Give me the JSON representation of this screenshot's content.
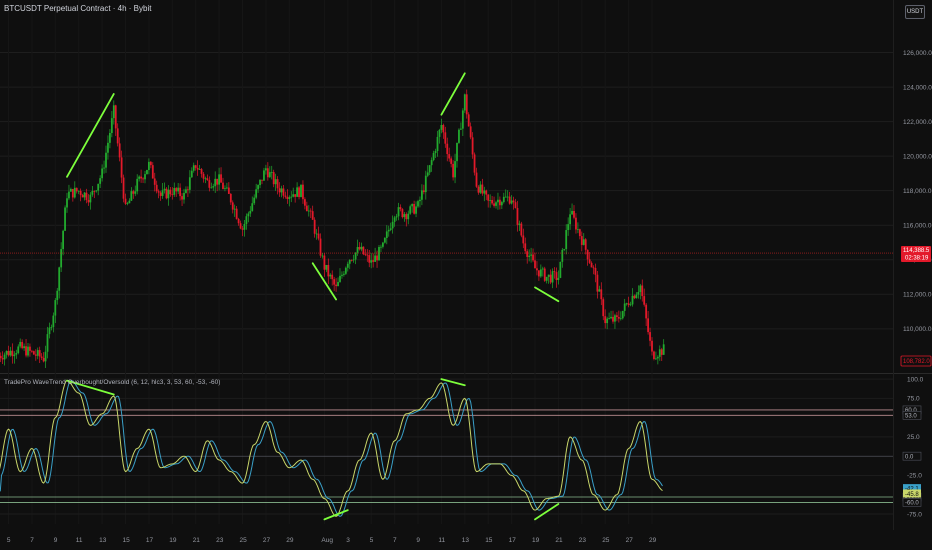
{
  "header": {
    "symbol_title": "BTCUSDT Perpetual Contract · 4h · Bybit",
    "currency_button": "USDT"
  },
  "indicator": {
    "label": "TradePro WaveTrend Overbought/Oversold (6, 12, hlc3, 3, 53, 60, -53, -60)"
  },
  "colors": {
    "background": "#0f0f0f",
    "bull_candle": "#22ab2e",
    "bear_candle": "#e3192a",
    "divergence_line": "#7dff3c",
    "price_line": "#ff2a2a",
    "wt1": "#c8d66a",
    "wt2": "#3aa0c8",
    "ob_zone": "#d9a4a8",
    "os_zone": "#9ed6a3"
  },
  "chart_data": [
    {
      "type": "candlestick",
      "title": "BTCUSDT Perpetual Contract · 4h · Bybit",
      "x_ticks": [
        "5",
        "7",
        "9",
        "11",
        "13",
        "15",
        "17",
        "19",
        "21",
        "23",
        "25",
        "27",
        "29",
        "Aug",
        "3",
        "5",
        "7",
        "9",
        "11",
        "13",
        "15",
        "17",
        "19",
        "21",
        "23",
        "25",
        "27",
        "29"
      ],
      "y_ticks": [
        "110,000.0",
        "112,000.0",
        "114,000.0",
        "116,000.0",
        "118,000.0",
        "120,000.0",
        "122,000.0",
        "124,000.0",
        "126,000.0"
      ],
      "ylim": [
        107500,
        128000
      ],
      "current_price": {
        "value": "114,388.5",
        "countdown": "02:38:19"
      },
      "low_tag": "108,782.0",
      "close_path": [
        {
          "x": "Jul 4",
          "close": 108400
        },
        {
          "x": "Jul 6",
          "close": 108900
        },
        {
          "x": "Jul 8",
          "close": 108300
        },
        {
          "x": "Jul 9",
          "close": 111500
        },
        {
          "x": "Jul 10",
          "close": 117800
        },
        {
          "x": "Jul 11",
          "close": 118000
        },
        {
          "x": "Jul 12",
          "close": 117600
        },
        {
          "x": "Jul 13",
          "close": 119000
        },
        {
          "x": "Jul 14",
          "close": 122600
        },
        {
          "x": "Jul 15",
          "close": 116900
        },
        {
          "x": "Jul 16",
          "close": 118400
        },
        {
          "x": "Jul 17",
          "close": 119500
        },
        {
          "x": "Jul 18",
          "close": 117700
        },
        {
          "x": "Jul 19",
          "close": 118000
        },
        {
          "x": "Jul 20",
          "close": 117700
        },
        {
          "x": "Jul 21",
          "close": 119500
        },
        {
          "x": "Jul 22",
          "close": 118500
        },
        {
          "x": "Jul 23",
          "close": 118600
        },
        {
          "x": "Jul 24",
          "close": 117500
        },
        {
          "x": "Jul 25",
          "close": 115800
        },
        {
          "x": "Jul 26",
          "close": 117600
        },
        {
          "x": "Jul 27",
          "close": 119300
        },
        {
          "x": "Jul 28",
          "close": 118200
        },
        {
          "x": "Jul 29",
          "close": 117800
        },
        {
          "x": "Jul 30",
          "close": 118000
        },
        {
          "x": "Jul 31",
          "close": 116200
        },
        {
          "x": "Aug 1",
          "close": 113600
        },
        {
          "x": "Aug 2",
          "close": 112300
        },
        {
          "x": "Aug 3",
          "close": 114000
        },
        {
          "x": "Aug 4",
          "close": 114600
        },
        {
          "x": "Aug 5",
          "close": 113800
        },
        {
          "x": "Aug 6",
          "close": 114700
        },
        {
          "x": "Aug 7",
          "close": 116800
        },
        {
          "x": "Aug 8",
          "close": 116700
        },
        {
          "x": "Aug 9",
          "close": 117100
        },
        {
          "x": "Aug 10",
          "close": 119300
        },
        {
          "x": "Aug 11",
          "close": 121800
        },
        {
          "x": "Aug 12",
          "close": 119000
        },
        {
          "x": "Aug 13",
          "close": 123400
        },
        {
          "x": "Aug 14",
          "close": 118400
        },
        {
          "x": "Aug 15",
          "close": 117300
        },
        {
          "x": "Aug 16",
          "close": 117500
        },
        {
          "x": "Aug 17",
          "close": 117600
        },
        {
          "x": "Aug 18",
          "close": 115000
        },
        {
          "x": "Aug 19",
          "close": 113500
        },
        {
          "x": "Aug 20",
          "close": 113000
        },
        {
          "x": "Aug 21",
          "close": 113000
        },
        {
          "x": "Aug 22",
          "close": 116800
        },
        {
          "x": "Aug 23",
          "close": 115200
        },
        {
          "x": "Aug 24",
          "close": 113400
        },
        {
          "x": "Aug 25",
          "close": 110500
        },
        {
          "x": "Aug 26",
          "close": 110500
        },
        {
          "x": "Aug 27",
          "close": 111600
        },
        {
          "x": "Aug 28",
          "close": 112500
        },
        {
          "x": "Aug 29",
          "close": 108500
        },
        {
          "x": "Aug 30",
          "close": 108800
        }
      ],
      "divergences": [
        {
          "from": {
            "x": "Jul 10",
            "price": 118800
          },
          "to": {
            "x": "Jul 14",
            "price": 123600
          }
        },
        {
          "from": {
            "x": "Jul 31",
            "price": 113800
          },
          "to": {
            "x": "Aug 2",
            "price": 111700
          }
        },
        {
          "from": {
            "x": "Aug 11",
            "price": 122400
          },
          "to": {
            "x": "Aug 13",
            "price": 124800
          }
        },
        {
          "from": {
            "x": "Aug 19",
            "price": 112400
          },
          "to": {
            "x": "Aug 21",
            "price": 111600
          }
        }
      ]
    },
    {
      "type": "line",
      "title": "TradePro WaveTrend Overbought/Oversold (6, 12, hlc3, 3, 53, 60, -53, -60)",
      "y_ticks": [
        "100.0",
        "75.0",
        "25.0",
        "-25.0",
        "-75.0"
      ],
      "ylim": [
        -88,
        104
      ],
      "levels": [
        "60.0",
        "53.0",
        "0.0",
        "-53.0",
        "-60.0"
      ],
      "tags": {
        "wt2": "-42.1",
        "wt1": "-45.8"
      },
      "series": [
        {
          "values_by_day": [
            {
              "x": "Jul 4",
              "y": -25
            },
            {
              "x": "Jul 5",
              "y": 35
            },
            {
              "x": "Jul 6",
              "y": -20
            },
            {
              "x": "Jul 7",
              "y": 10
            },
            {
              "x": "Jul 8",
              "y": -35
            },
            {
              "x": "Jul 9",
              "y": 50
            },
            {
              "x": "Jul 10",
              "y": 98
            },
            {
              "x": "Jul 11",
              "y": 82
            },
            {
              "x": "Jul 12",
              "y": 40
            },
            {
              "x": "Jul 13",
              "y": 55
            },
            {
              "x": "Jul 14",
              "y": 78
            },
            {
              "x": "Jul 15",
              "y": -20
            },
            {
              "x": "Jul 16",
              "y": 10
            },
            {
              "x": "Jul 17",
              "y": 35
            },
            {
              "x": "Jul 18",
              "y": -15
            },
            {
              "x": "Jul 19",
              "y": -10
            },
            {
              "x": "Jul 20",
              "y": 0
            },
            {
              "x": "Jul 21",
              "y": -20
            },
            {
              "x": "Jul 22",
              "y": 20
            },
            {
              "x": "Jul 23",
              "y": -5
            },
            {
              "x": "Jul 24",
              "y": -20
            },
            {
              "x": "Jul 25",
              "y": -35
            },
            {
              "x": "Jul 26",
              "y": 15
            },
            {
              "x": "Jul 27",
              "y": 45
            },
            {
              "x": "Jul 28",
              "y": 5
            },
            {
              "x": "Jul 29",
              "y": -15
            },
            {
              "x": "Jul 30",
              "y": -5
            },
            {
              "x": "Jul 31",
              "y": -30
            },
            {
              "x": "Aug 1",
              "y": -55
            },
            {
              "x": "Aug 2",
              "y": -78
            },
            {
              "x": "Aug 3",
              "y": -45
            },
            {
              "x": "Aug 4",
              "y": -5
            },
            {
              "x": "Aug 5",
              "y": 30
            },
            {
              "x": "Aug 6",
              "y": -30
            },
            {
              "x": "Aug 7",
              "y": 20
            },
            {
              "x": "Aug 8",
              "y": 55
            },
            {
              "x": "Aug 9",
              "y": 60
            },
            {
              "x": "Aug 10",
              "y": 75
            },
            {
              "x": "Aug 11",
              "y": 95
            },
            {
              "x": "Aug 12",
              "y": 40
            },
            {
              "x": "Aug 13",
              "y": 75
            },
            {
              "x": "Aug 14",
              "y": -20
            },
            {
              "x": "Aug 15",
              "y": -10
            },
            {
              "x": "Aug 16",
              "y": -10
            },
            {
              "x": "Aug 17",
              "y": -25
            },
            {
              "x": "Aug 18",
              "y": -45
            },
            {
              "x": "Aug 19",
              "y": -70
            },
            {
              "x": "Aug 20",
              "y": -55
            },
            {
              "x": "Aug 21",
              "y": -52
            },
            {
              "x": "Aug 22",
              "y": 25
            },
            {
              "x": "Aug 23",
              "y": -5
            },
            {
              "x": "Aug 24",
              "y": -50
            },
            {
              "x": "Aug 25",
              "y": -70
            },
            {
              "x": "Aug 26",
              "y": -50
            },
            {
              "x": "Aug 27",
              "y": 10
            },
            {
              "x": "Aug 28",
              "y": 45
            },
            {
              "x": "Aug 29",
              "y": -30
            },
            {
              "x": "Aug 30",
              "y": -45
            }
          ]
        }
      ],
      "divergences": [
        {
          "from": {
            "x": "Jul 10",
            "y": 98
          },
          "to": {
            "x": "Jul 14",
            "y": 80
          }
        },
        {
          "from": {
            "x": "Aug 1",
            "y": -82
          },
          "to": {
            "x": "Aug 3",
            "y": -70
          }
        },
        {
          "from": {
            "x": "Aug 11",
            "y": 100
          },
          "to": {
            "x": "Aug 13",
            "y": 92
          }
        },
        {
          "from": {
            "x": "Aug 19",
            "y": -82
          },
          "to": {
            "x": "Aug 21",
            "y": -62
          }
        }
      ]
    }
  ]
}
